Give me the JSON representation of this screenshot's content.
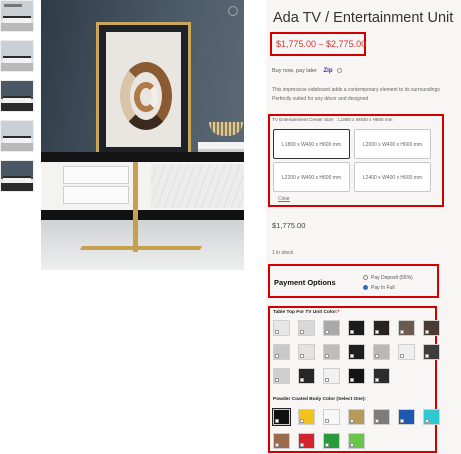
{
  "product": {
    "title": "Ada TV / Entertainment Unit",
    "price_range": "$1,775.00 – $2,775.00",
    "pay_later": "Buy now, pay later",
    "zip_label": "Zip",
    "description": "This impressive sideboard adds a contemporary element to its surroundings Perfectly suited for any décor and designed",
    "size_label": "TV Entertainment Center Size: : L1800 x W400 x H600 mm",
    "sizes": [
      "L1800 x W400 x H600 mm",
      "L2000 x W400 x H600 mm",
      "L2200 x W400 x H600 mm",
      "L2400 x W400 x H600 mm"
    ],
    "selected_size_index": 0,
    "clear_label": "Clear",
    "price": "$1,775.00",
    "stock": "1 in stock"
  },
  "payment": {
    "title": "Payment Options",
    "options": [
      "Pay Deposit (65%)",
      "Pay In Full"
    ],
    "selected_index": 1
  },
  "table_top": {
    "title": "Table Top For TV Unit Color:",
    "required_mark": "*",
    "swatches": [
      "#e6e6e6",
      "#d9d9d9",
      "#a9a9a9",
      "#1b1b1b",
      "#2b2321",
      "#6b5a4d",
      "#4a3a34",
      "#c9c9c9",
      "#e2e2e2",
      "#bdbdbd",
      "#1e1e1e",
      "#b8b8b8",
      "#efefef",
      "#3d3d3d",
      "#cfcfcf",
      "#262626",
      "#f0f0f0",
      "#151515",
      "#2d2d2d"
    ]
  },
  "body_color": {
    "title": "Powder Coated Body Color (Select One):",
    "swatches": [
      "#111111",
      "#f2c31b",
      "#f7f7f7",
      "#b79a5b",
      "#7c7c7c",
      "#1d57b0",
      "#30c7d3",
      "#9b6b4d",
      "#d2242b",
      "#2b9a3c",
      "#69c64a"
    ],
    "selected_index": 0
  },
  "colors": {
    "highlight": "#d40000",
    "price": "#c33333",
    "radio_on": "#2a6fd0"
  },
  "icons": [
    "zoom-icon",
    "info-icon"
  ]
}
